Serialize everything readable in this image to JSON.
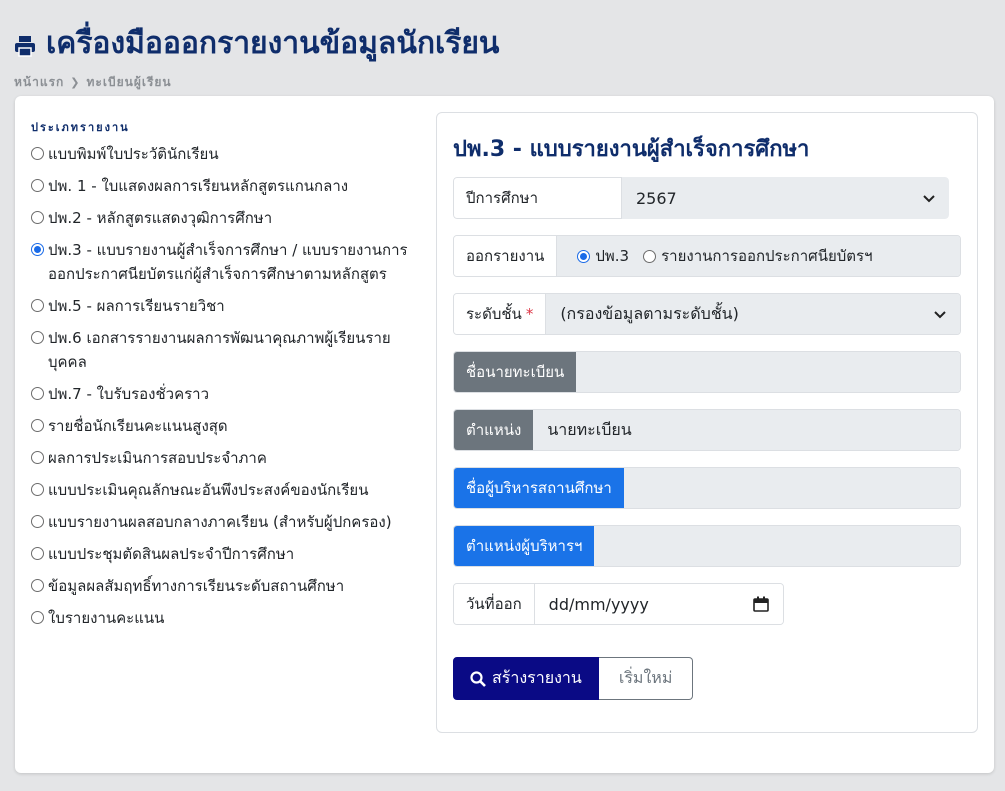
{
  "header": {
    "title": "เครื่องมือออกรายงานข้อมูลนักเรียน",
    "breadcrumb": [
      "หน้าแรก",
      "ทะเบียนผู้เรียน"
    ]
  },
  "report_types": {
    "label": "ประเภทรายงาน",
    "selected_index": 3,
    "items": [
      "แบบพิมพ์ใบประวัตินักเรียน",
      "ปพ. 1 - ใบแสดงผลการเรียนหลักสูตรแกนกลาง",
      "ปพ.2 - หลักสูตรแสดงวุฒิการศึกษา",
      "ปพ.3 - แบบรายงานผู้สำเร็จการศึกษา / แบบรายงานการออกประกาศนียบัตรแก่ผู้สำเร็จการศึกษาตามหลักสูตร",
      "ปพ.5 - ผลการเรียนรายวิชา",
      "ปพ.6 เอกสารรายงานผลการพัฒนาคุณภาพผู้เรียนรายบุคคล",
      "ปพ.7 - ใบรับรองชั่วคราว",
      "รายชื่อนักเรียนคะแนนสูงสุด",
      "ผลการประเมินการสอบประจำภาค",
      "แบบประเมินคุณลักษณะอันพึงประสงค์ของนักเรียน",
      "แบบรายงานผลสอบกลางภาคเรียน (สำหรับผู้ปกครอง)",
      "แบบประชุมตัดสินผลประจำปีการศึกษา",
      "ข้อมูลผลสัมฤทธิ์ทางการเรียนระดับสถานศึกษา",
      "ใบรายงานคะแนน"
    ]
  },
  "form": {
    "title": "ปพ.3 - แบบรายงานผู้สำเร็จการศึกษา",
    "year": {
      "label": "ปีการศึกษา",
      "value": "2567"
    },
    "output": {
      "label": "ออกรายงาน",
      "options": [
        "ปพ.3",
        "รายงานการออกประกาศนียบัตรฯ"
      ],
      "selected": "ปพ.3"
    },
    "level": {
      "label": "ระดับชั้น",
      "required_mark": "*",
      "value": "(กรองข้อมูลตามระดับชั้น)"
    },
    "registrar_name": {
      "label": "ชื่อนายทะเบียน",
      "value": ""
    },
    "position": {
      "label": "ตำแหน่ง",
      "value": "นายทะเบียน"
    },
    "director_name": {
      "label": "ชื่อผู้บริหารสถานศึกษา",
      "value": ""
    },
    "director_position": {
      "label": "ตำแหน่งผู้บริหารฯ",
      "value": ""
    },
    "issue_date": {
      "label": "วันที่ออก",
      "placeholder": "dd/mm/yyyy"
    },
    "submit_label": "สร้างรายงาน",
    "reset_label": "เริ่มใหม่"
  },
  "colors": {
    "primary": "#0a0a85",
    "heading": "#0f2d6b",
    "addon_gray": "#6c757d",
    "addon_blue": "#1a73e8",
    "required": "#dc3545"
  },
  "icons": [
    "printer-icon",
    "chevron-right-icon",
    "chevron-down-icon",
    "calendar-icon",
    "search-icon"
  ]
}
